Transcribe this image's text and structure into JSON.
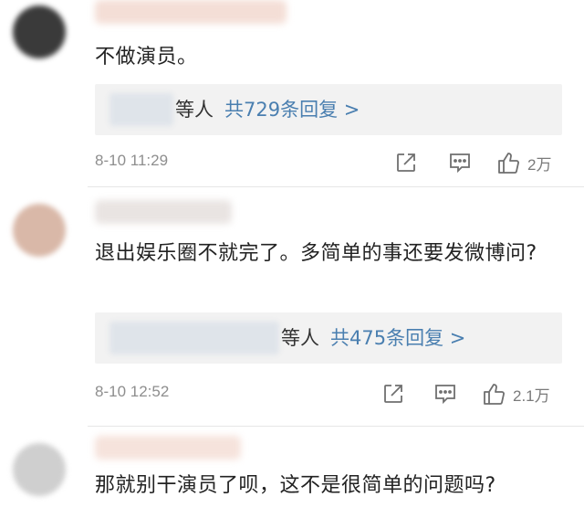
{
  "comments": [
    {
      "text": "不做演员。",
      "reply": {
        "names": "等人",
        "count": "共729条回复 >"
      },
      "time": "8-10 11:29",
      "likes": "2万"
    },
    {
      "text": "退出娱乐圈不就完了。多简单的事还要发微博问?",
      "reply": {
        "names": "等人",
        "count": "共475条回复 >"
      },
      "time": "8-10 12:52",
      "likes": "2.1万"
    },
    {
      "text": "那就别干演员了呗，这不是很简单的问题吗?"
    }
  ],
  "icons": {
    "share": "share-icon",
    "comment": "comment-icon",
    "like": "thumbs-up-icon"
  },
  "colors": {
    "link": "#4a7fb0",
    "meta": "#8e8e8e",
    "reply_bg": "#f2f2f2"
  }
}
